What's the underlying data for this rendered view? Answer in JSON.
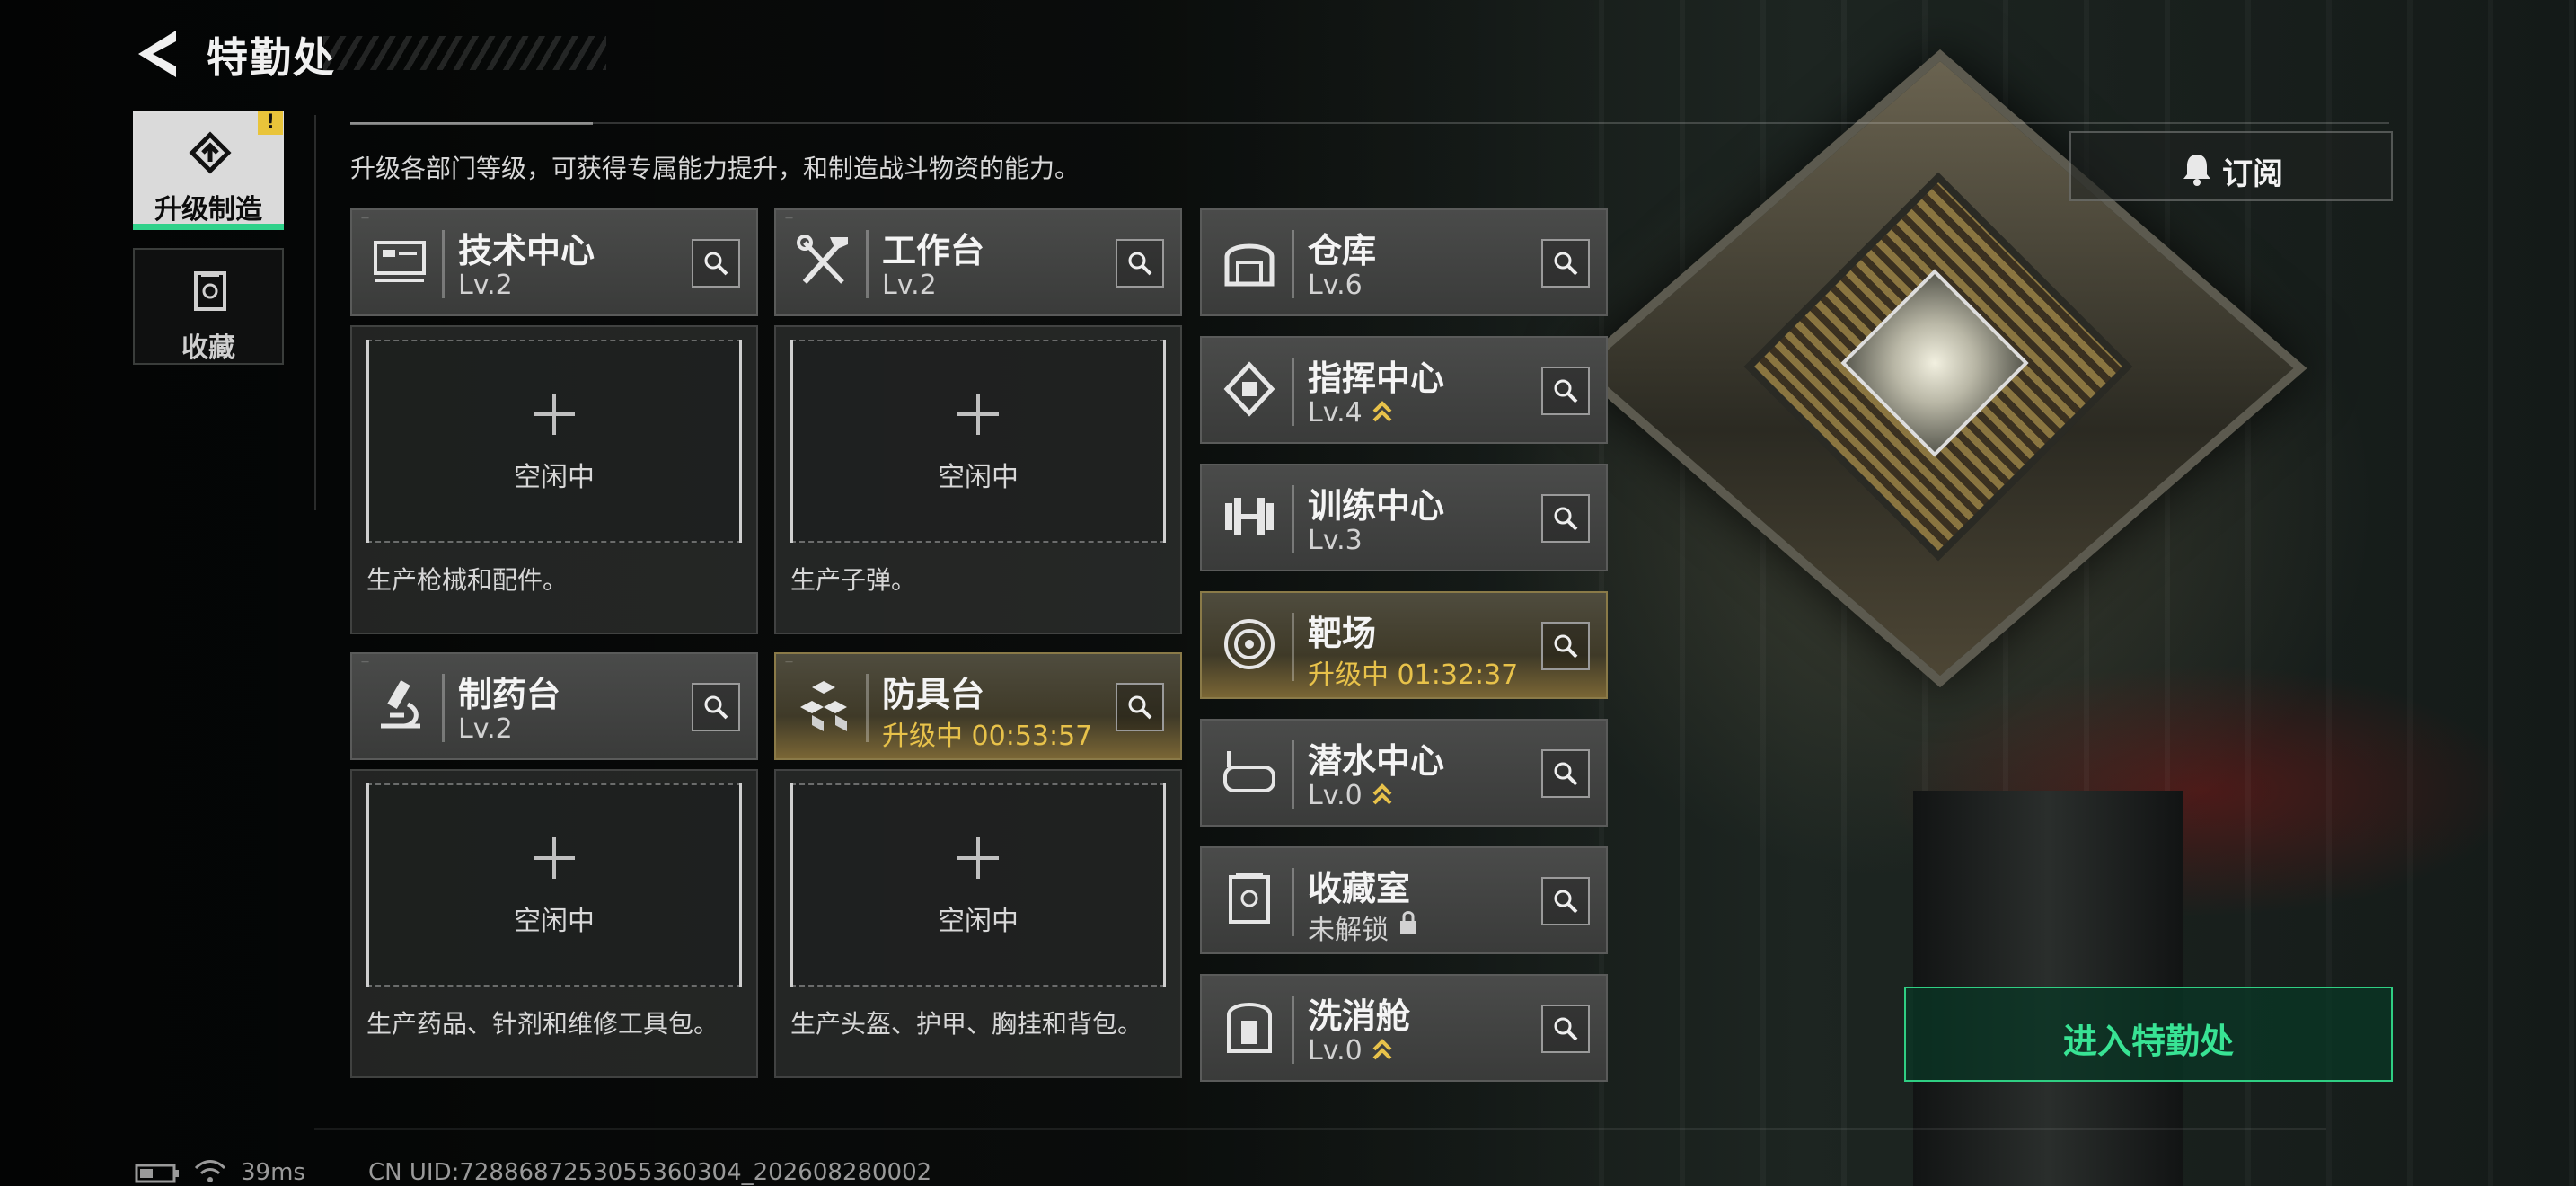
{
  "header": {
    "title": "特勤处"
  },
  "nav": {
    "items": [
      {
        "label": "升级制造",
        "icon": "upgrade-craft-icon",
        "active": true,
        "badge": "!"
      },
      {
        "label": "收藏",
        "icon": "collection-icon",
        "active": false
      }
    ]
  },
  "subtitle": "升级各部门等级，可获得专属能力提升，和制造战斗物资的能力。",
  "subscribe": {
    "label": "订阅",
    "icon": "bell-icon"
  },
  "workshops": [
    {
      "name": "技术中心",
      "level": "Lv.2",
      "icon": "computer-icon",
      "slot": "空闲中",
      "desc": "生产枪械和配件。"
    },
    {
      "name": "工作台",
      "level": "Lv.2",
      "icon": "tools-icon",
      "slot": "空闲中",
      "desc": "生产子弹。"
    },
    {
      "name": "制药台",
      "level": "Lv.2",
      "icon": "microscope-icon",
      "slot": "空闲中",
      "desc": "生产药品、针剂和维修工具包。"
    },
    {
      "name": "防具台",
      "level": "升级中 00:53:57",
      "icon": "armor-cubes-icon",
      "upgrading": true,
      "slot": "空闲中",
      "desc": "生产头盔、护甲、胸挂和背包。"
    }
  ],
  "facilities": [
    {
      "name": "仓库",
      "level": "Lv.6",
      "icon": "warehouse-icon"
    },
    {
      "name": "指挥中心",
      "level": "Lv.4",
      "icon": "command-chip-icon",
      "upgradable": true
    },
    {
      "name": "训练中心",
      "level": "Lv.3",
      "icon": "dumbbell-icon"
    },
    {
      "name": "靶场",
      "level": "升级中 01:32:37",
      "icon": "target-icon",
      "upgrading": true
    },
    {
      "name": "潜水中心",
      "level": "Lv.0",
      "icon": "diving-mask-icon",
      "upgradable": true
    },
    {
      "name": "收藏室",
      "level": "未解锁",
      "icon": "display-case-icon",
      "locked": true
    },
    {
      "name": "洗消舱",
      "level": "Lv.0",
      "icon": "decontamination-icon",
      "upgradable": true
    }
  ],
  "enter_button": {
    "label": "进入特勤处"
  },
  "status_bar": {
    "ping": "39ms",
    "uid": "CN UID:7288687253055360304_202608280002"
  },
  "colors": {
    "accent_green": "#2fd18a",
    "upgrade_gold": "#e8c24a",
    "warning_yellow": "#e9c43a"
  }
}
